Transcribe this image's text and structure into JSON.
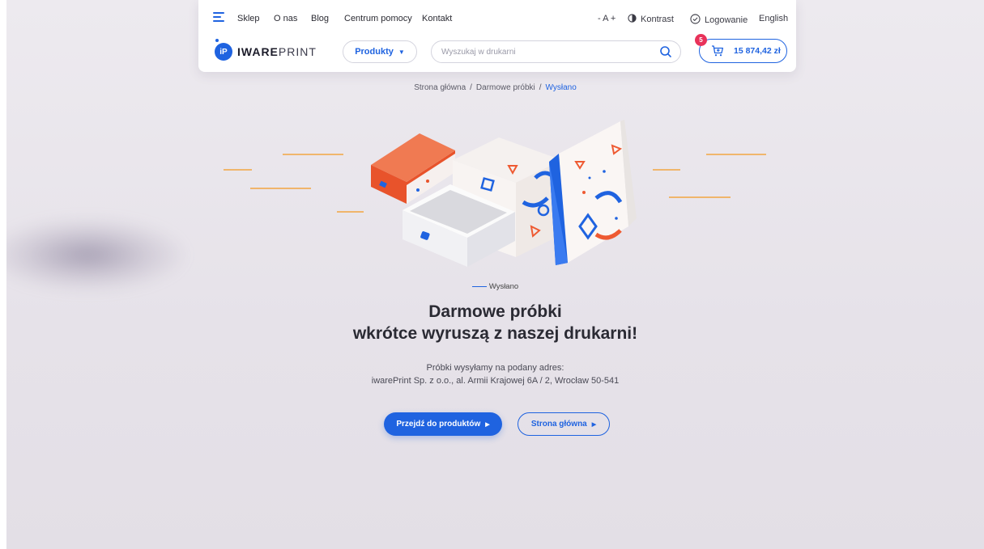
{
  "nav": {
    "links": [
      "Sklep",
      "O nas",
      "Blog",
      "Centrum pomocy",
      "Kontakt"
    ],
    "font_size": "- A +",
    "contrast": "Kontrast",
    "login": "Logowanie",
    "language": "English"
  },
  "logo": {
    "bold": "IWARE",
    "light": "PRINT",
    "mark": "iP"
  },
  "products_button": "Produkty",
  "search": {
    "placeholder": "Wyszukaj w drukarni"
  },
  "cart": {
    "count": "5",
    "total": "15 874,42 zł"
  },
  "breadcrumb": [
    "Strona główna",
    "Darmowe próbki",
    "Wysłano"
  ],
  "status": "Wysłano",
  "headline": {
    "line1": "Darmowe próbki",
    "line2": "wkrótce wyruszą z naszej drukarni!"
  },
  "subtext": {
    "line1": "Próbki wysyłamy na podany adres:",
    "line2": "iwarePrint Sp. z o.o., al. Armii Krajowej 6A / 2, Wrocław 50-541"
  },
  "buttons": {
    "primary": "Przejdź do produktów",
    "secondary": "Strona główna"
  },
  "colors": {
    "accent": "#1f63e0",
    "badge": "#e8325a",
    "orange": "#ee5a32",
    "line": "#f2a541"
  }
}
